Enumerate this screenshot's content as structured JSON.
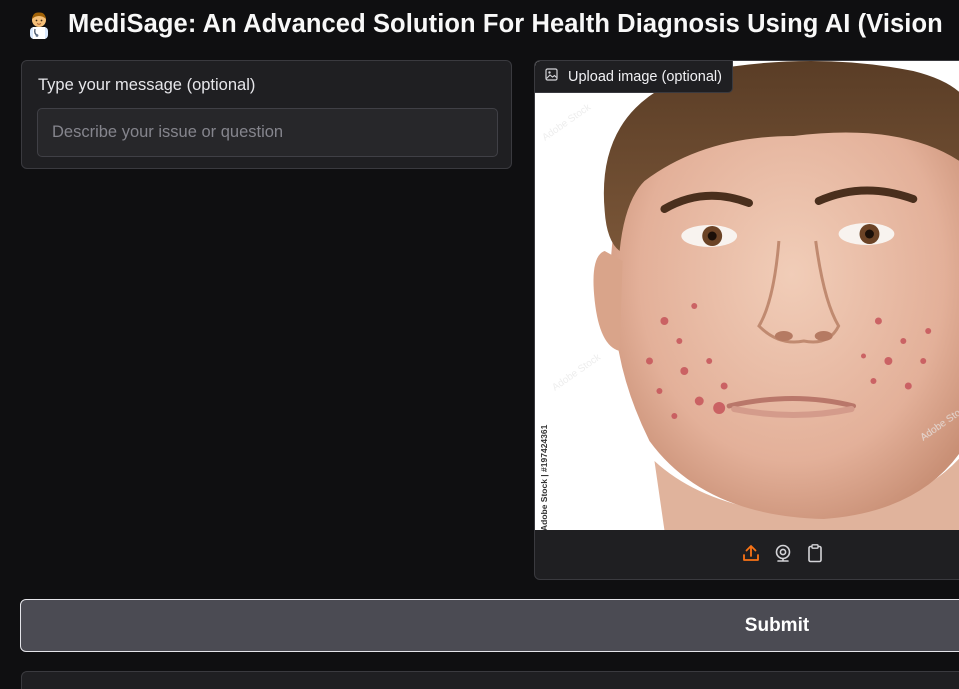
{
  "header": {
    "title": "MediSage: An Advanced Solution For Health Diagnosis Using AI (Vision",
    "emoji_icon": "health-worker-icon"
  },
  "message": {
    "label": "Type your message (optional)",
    "placeholder": "Describe your issue or question",
    "value": ""
  },
  "image_input": {
    "label": "Upload image (optional)",
    "label_icon": "image-icon",
    "watermark": "Adobe Stock | #197424361",
    "tools": [
      {
        "name": "upload-icon",
        "color": "#f97316"
      },
      {
        "name": "webcam-icon",
        "color": "#d4d4d8"
      },
      {
        "name": "clipboard-icon",
        "color": "#d4d4d8"
      }
    ]
  },
  "submit": {
    "label": "Submit"
  },
  "colors": {
    "background": "#0f0f11",
    "panel": "#1f1f22",
    "accent": "#f97316",
    "submit_bg": "#4b4b53"
  }
}
